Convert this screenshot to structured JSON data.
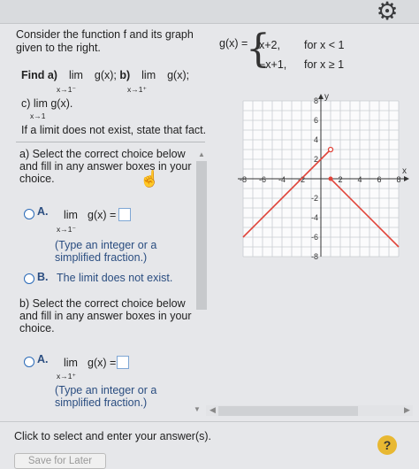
{
  "settings_icon": "gear-icon",
  "problem": {
    "intro": "Consider the function f and its graph given to the right.",
    "find_a": "Find a)",
    "lim": "lim",
    "gx": "g(x);",
    "find_b": "b)",
    "sub_a": "x→1⁻",
    "sub_b": "x→1⁺",
    "c_label": "c) lim",
    "c_gx": "g(x).",
    "sub_c": "x→1",
    "note": "If a limit does not exist, state that fact."
  },
  "definition": {
    "lhs": "g(x) =",
    "case1_expr": "x+2,",
    "case1_cond": "for x < 1",
    "case2_expr": "−x+1,",
    "case2_cond": "for x ≥ 1"
  },
  "graph": {
    "x_label": "x",
    "y_label": "y",
    "x_ticks": [
      "-8",
      "-6",
      "-4",
      "-2",
      "2",
      "4",
      "6",
      "8"
    ],
    "y_ticks": [
      "8",
      "6",
      "4",
      "2",
      "-2",
      "-4",
      "-6",
      "-8"
    ],
    "xlim": [
      -8,
      8
    ],
    "ylim": [
      -8,
      8
    ],
    "line_color": "#e0443a"
  },
  "part_a": {
    "prompt": "a) Select the correct choice below and fill in any answer boxes in your choice.",
    "option_a_letter": "A.",
    "option_a_lim": "lim",
    "option_a_sub": "x→1⁻",
    "option_a_gx": "g(x) =",
    "option_a_hint": "(Type an integer or a simplified fraction.)",
    "option_b_letter": "B.",
    "option_b_text": "The limit does not exist."
  },
  "part_b": {
    "prompt": "b) Select the correct choice below and fill in any answer boxes in your choice.",
    "option_a_letter": "A.",
    "option_a_lim": "lim",
    "option_a_sub": "x→1⁺",
    "option_a_gx": "g(x) =",
    "option_a_hint": "(Type an integer or a simplified fraction.)"
  },
  "footer": {
    "instruction": "Click to select and enter your answer(s).",
    "help_label": "?",
    "save_label": "Save for Later"
  }
}
